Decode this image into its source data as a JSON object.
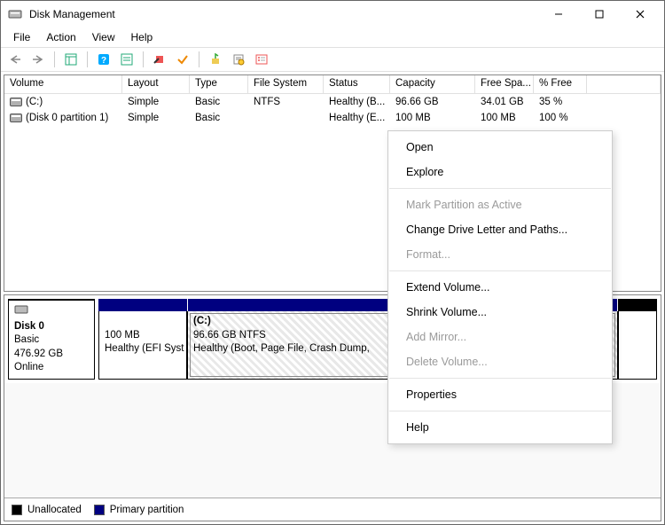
{
  "titlebar": {
    "title": "Disk Management"
  },
  "menu": {
    "file": "File",
    "action": "Action",
    "view": "View",
    "help": "Help"
  },
  "columns": {
    "volume": "Volume",
    "layout": "Layout",
    "type": "Type",
    "filesystem": "File System",
    "status": "Status",
    "capacity": "Capacity",
    "free": "Free Spa...",
    "pct": "% Free"
  },
  "volumes": [
    {
      "name": "(C:)",
      "layout": "Simple",
      "type": "Basic",
      "fs": "NTFS",
      "status": "Healthy (B...",
      "capacity": "96.66 GB",
      "free": "34.01 GB",
      "pct": "35 %"
    },
    {
      "name": "(Disk 0 partition 1)",
      "layout": "Simple",
      "type": "Basic",
      "fs": "",
      "status": "Healthy (E...",
      "capacity": "100 MB",
      "free": "100 MB",
      "pct": "100 %"
    }
  ],
  "disk": {
    "label": "Disk 0",
    "type": "Basic",
    "size": "476.92 GB",
    "state": "Online",
    "parts": [
      {
        "line1": "",
        "line2": "100 MB",
        "line3": "Healthy (EFI Syst"
      },
      {
        "line1": "(C:)",
        "line2": "96.66 GB NTFS",
        "line3": "Healthy (Boot, Page File, Crash Dump,"
      }
    ]
  },
  "legend": {
    "unalloc": "Unallocated",
    "primary": "Primary partition"
  },
  "ctx": {
    "open": "Open",
    "explore": "Explore",
    "markactive": "Mark Partition as Active",
    "changeletter": "Change Drive Letter and Paths...",
    "format": "Format...",
    "extend": "Extend Volume...",
    "shrink": "Shrink Volume...",
    "addmirror": "Add Mirror...",
    "delete": "Delete Volume...",
    "properties": "Properties",
    "help": "Help"
  }
}
